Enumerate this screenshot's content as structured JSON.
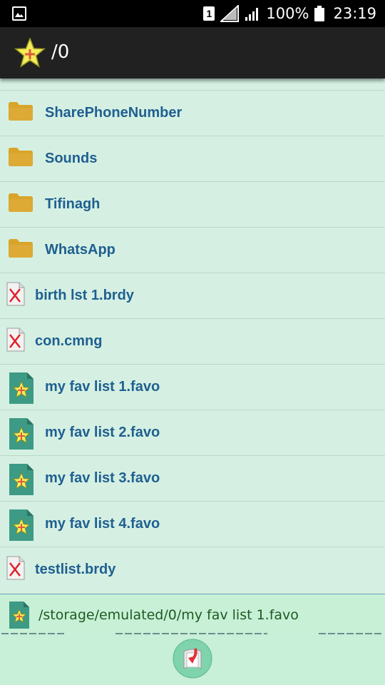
{
  "status_bar": {
    "sim_slot": "1",
    "battery": "100%",
    "time": "23:19",
    "icons": [
      "image-icon",
      "signal-icon",
      "battery-icon"
    ]
  },
  "app_bar": {
    "title": "/0",
    "icon": "star-plus-icon"
  },
  "files": [
    {
      "name": "SharePhoneNumber",
      "type": "folder"
    },
    {
      "name": "Sounds",
      "type": "folder"
    },
    {
      "name": "Tifinagh",
      "type": "folder"
    },
    {
      "name": "WhatsApp",
      "type": "folder"
    },
    {
      "name": "birth lst 1.brdy",
      "type": "brdy"
    },
    {
      "name": "con.cmng",
      "type": "brdy"
    },
    {
      "name": "my fav list 1.favo",
      "type": "favo"
    },
    {
      "name": "my fav list 2.favo",
      "type": "favo"
    },
    {
      "name": "my fav list 3.favo",
      "type": "favo"
    },
    {
      "name": "my fav list 4.favo",
      "type": "favo"
    },
    {
      "name": "testlist.brdy",
      "type": "brdy"
    }
  ],
  "selected_path": "/storage/emulated/0/my fav list 1.favo",
  "colors": {
    "list_bg": "#d5f0e2",
    "file_name": "#1f5f91",
    "path_text": "#1e5a22",
    "folder": "#d9a42a",
    "fab": "#7fd3ad"
  }
}
